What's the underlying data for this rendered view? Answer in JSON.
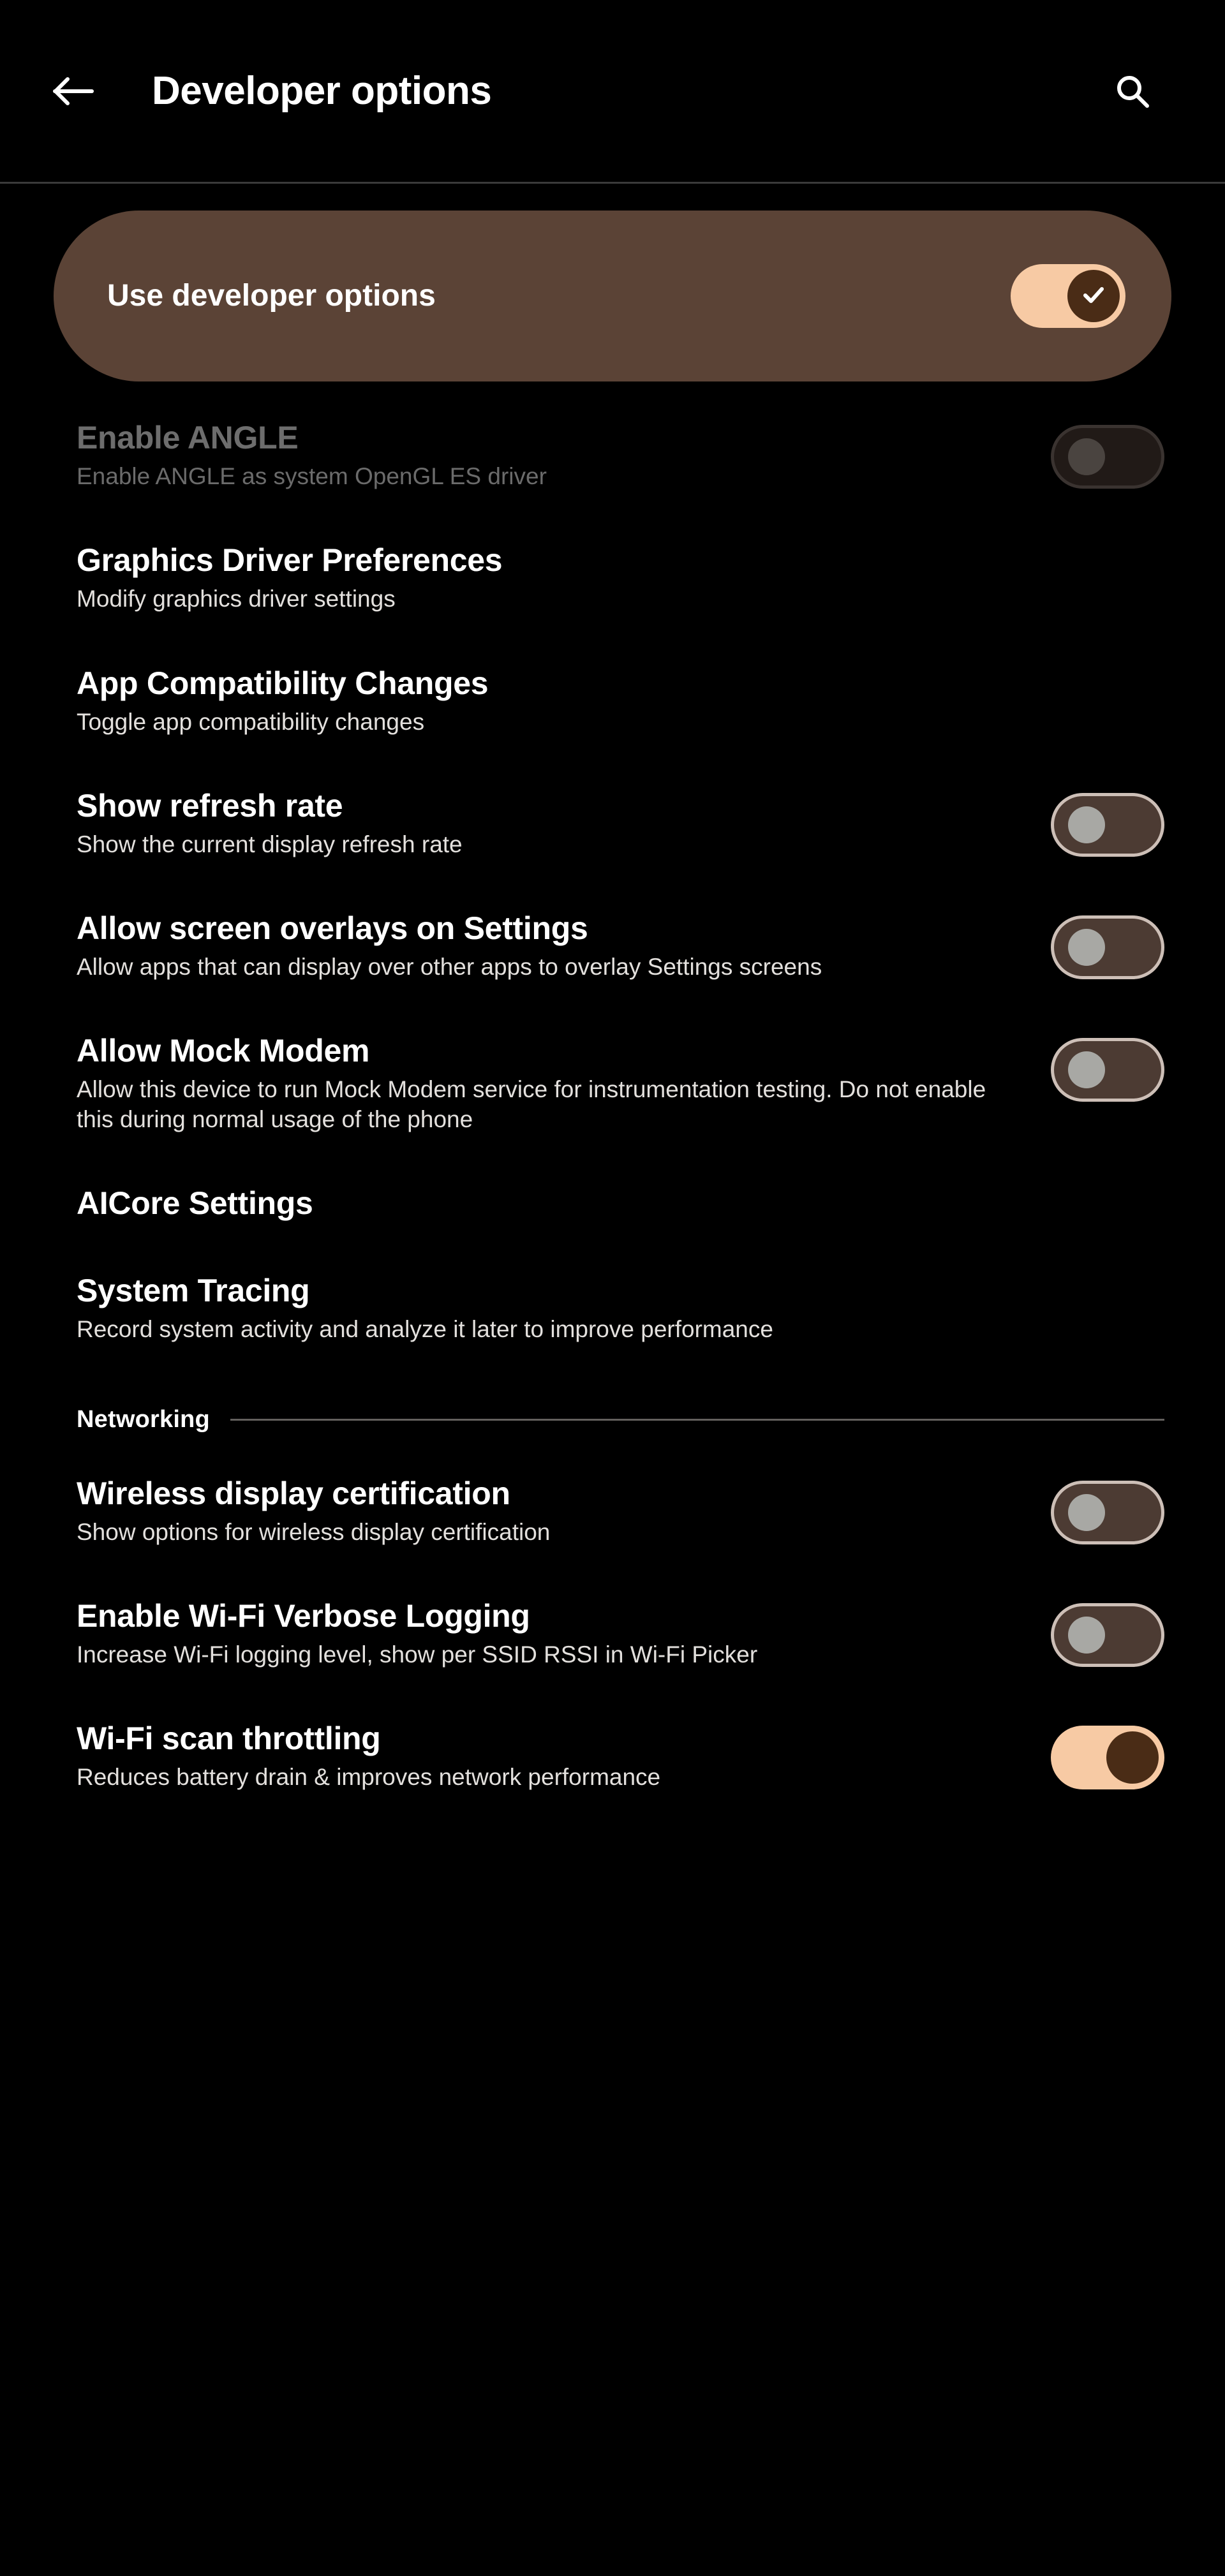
{
  "header": {
    "title": "Developer options",
    "back_icon": "arrow-left-icon",
    "search_icon": "search-icon"
  },
  "banner": {
    "label": "Use developer options",
    "toggle_state": "on",
    "toggle_icon": "check-icon",
    "track_color": "#f7caa4",
    "thumb_color": "#4a2c16",
    "background_color": "#5b4336"
  },
  "colors": {
    "page_background": "#000000",
    "accent": "#f7caa4",
    "toggle_off_track": "#4c3b33",
    "toggle_off_border": "#cdbfb7",
    "toggle_off_thumb": "#a8a8a4",
    "disabled_text": "#6d6d6d",
    "subtitle_text": "#e3e0dd",
    "divider": "#63605d"
  },
  "rows": [
    {
      "title": "Enable ANGLE",
      "subtitle": "Enable ANGLE as system OpenGL ES driver",
      "toggle": "off",
      "disabled": true
    },
    {
      "title": "Graphics Driver Preferences",
      "subtitle": "Modify graphics driver settings",
      "toggle": null,
      "disabled": false
    },
    {
      "title": "App Compatibility Changes",
      "subtitle": "Toggle app compatibility changes",
      "toggle": null,
      "disabled": false
    },
    {
      "title": "Show refresh rate",
      "subtitle": "Show the current display refresh rate",
      "toggle": "off",
      "disabled": false
    },
    {
      "title": "Allow screen overlays on Settings",
      "subtitle": "Allow apps that can display over other apps to overlay Settings screens",
      "toggle": "off",
      "disabled": false
    },
    {
      "title": "Allow Mock Modem",
      "subtitle": "Allow this device to run Mock Modem service for instrumentation testing. Do not enable this during normal usage of the phone",
      "toggle": "off",
      "disabled": false
    },
    {
      "title": "AICore Settings",
      "subtitle": "",
      "toggle": null,
      "disabled": false
    },
    {
      "title": "System Tracing",
      "subtitle": "Record system activity and analyze it later to improve performance",
      "toggle": null,
      "disabled": false
    }
  ],
  "section_networking": {
    "label": "Networking"
  },
  "rows_networking": [
    {
      "title": "Wireless display certification",
      "subtitle": "Show options for wireless display certification",
      "toggle": "off",
      "disabled": false
    },
    {
      "title": "Enable Wi-Fi Verbose Logging",
      "subtitle": "Increase Wi-Fi logging level, show per SSID RSSI in Wi-Fi Picker",
      "toggle": "off",
      "disabled": false
    },
    {
      "title": "Wi-Fi scan throttling",
      "subtitle": "Reduces battery drain & improves network performance",
      "toggle": "on",
      "disabled": false
    }
  ]
}
